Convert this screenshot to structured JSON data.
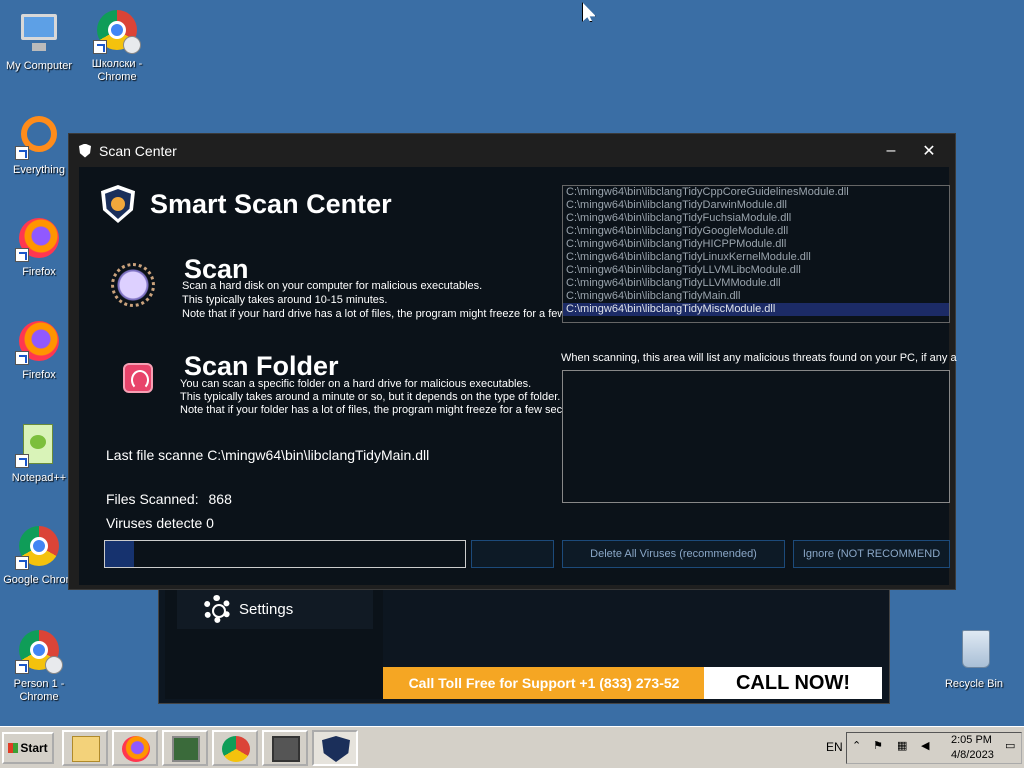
{
  "desktop": {
    "icons": [
      {
        "label": "My Computer",
        "icon": "my-computer-icon"
      },
      {
        "label": "Школски - Chrome",
        "icon": "chrome-icon"
      },
      {
        "label": "Everything",
        "icon": "everything-icon"
      },
      {
        "label": "Firefox",
        "icon": "firefox-icon"
      },
      {
        "label": "Firefox",
        "icon": "firefox-icon"
      },
      {
        "label": "Notepad++",
        "icon": "notepad-plus-plus-icon"
      },
      {
        "label": "Google Chrom",
        "icon": "chrome-icon"
      },
      {
        "label": "Person 1 - Chrome",
        "icon": "chrome-icon"
      },
      {
        "label": "Recycle Bin",
        "icon": "recycle-bin-icon"
      }
    ]
  },
  "background_window": {
    "settings_label": "Settings",
    "toll_free_text": "Call Toll Free for Support +1 (833) 273-52",
    "call_now_label": "CALL NOW!",
    "colors": {
      "banner": "#f5a623",
      "call_now_bg": "#ffffff"
    }
  },
  "window": {
    "title": "Scan Center",
    "minimize_label": "–",
    "close_label": "✕"
  },
  "app": {
    "title": "Smart Scan Center",
    "scan": {
      "title": "Scan",
      "lines": [
        "Scan a hard disk on your computer for malicious executables.",
        "This typically takes around 10-15 minutes.",
        "Note that if your hard drive has a lot of files, the program might freeze for a few seconds."
      ]
    },
    "scan_folder": {
      "title": "Scan Folder",
      "lines": [
        "You can scan a specific folder on a hard drive for malicious executables.",
        "This typically takes around a minute or so, but it depends on the type of folder.",
        "Note that if your folder has a lot of files, the program might freeze for a few seconds."
      ]
    },
    "last_file_label": "Last file scanne",
    "last_file_value": "C:\\mingw64\\bin\\libclangTidyMain.dll",
    "files_scanned_label": "Files Scanned:",
    "files_scanned_value": "868",
    "viruses_label": "Viruses detecte",
    "viruses_value": "0",
    "progress_fraction": 0.08,
    "buttons": {
      "hidden_label": "",
      "delete_all": "Delete All Viruses (recommended)",
      "ignore": "Ignore (NOT RECOMMEND"
    },
    "file_list": [
      {
        "path": "C:\\mingw64\\bin\\libclangTidyCppCoreGuidelinesModule.dll",
        "selected": false
      },
      {
        "path": "C:\\mingw64\\bin\\libclangTidyDarwinModule.dll",
        "selected": false
      },
      {
        "path": "C:\\mingw64\\bin\\libclangTidyFuchsiaModule.dll",
        "selected": false
      },
      {
        "path": "C:\\mingw64\\bin\\libclangTidyGoogleModule.dll",
        "selected": false
      },
      {
        "path": "C:\\mingw64\\bin\\libclangTidyHICPPModule.dll",
        "selected": false
      },
      {
        "path": "C:\\mingw64\\bin\\libclangTidyLinuxKernelModule.dll",
        "selected": false
      },
      {
        "path": "C:\\mingw64\\bin\\libclangTidyLLVMLibcModule.dll",
        "selected": false
      },
      {
        "path": "C:\\mingw64\\bin\\libclangTidyLLVMModule.dll",
        "selected": false
      },
      {
        "path": "C:\\mingw64\\bin\\libclangTidyMain.dll",
        "selected": false
      },
      {
        "path": "C:\\mingw64\\bin\\libclangTidyMiscModule.dll",
        "selected": true
      }
    ],
    "threats_hint": "When scanning, this area will list any malicious threats found on your PC, if any a",
    "colors": {
      "accent": "#16326e",
      "panel_bg": "#0b1219",
      "button_border": "#1c4a7a"
    }
  },
  "taskbar": {
    "start_label": "Start",
    "buttons": [
      "file-explorer-icon",
      "firefox-icon",
      "task-manager-icon",
      "chrome-icon",
      "windows-switcher-icon",
      "scan-center-icon"
    ],
    "language": "EN",
    "time": "2:05 PM",
    "date": "4/8/2023"
  }
}
